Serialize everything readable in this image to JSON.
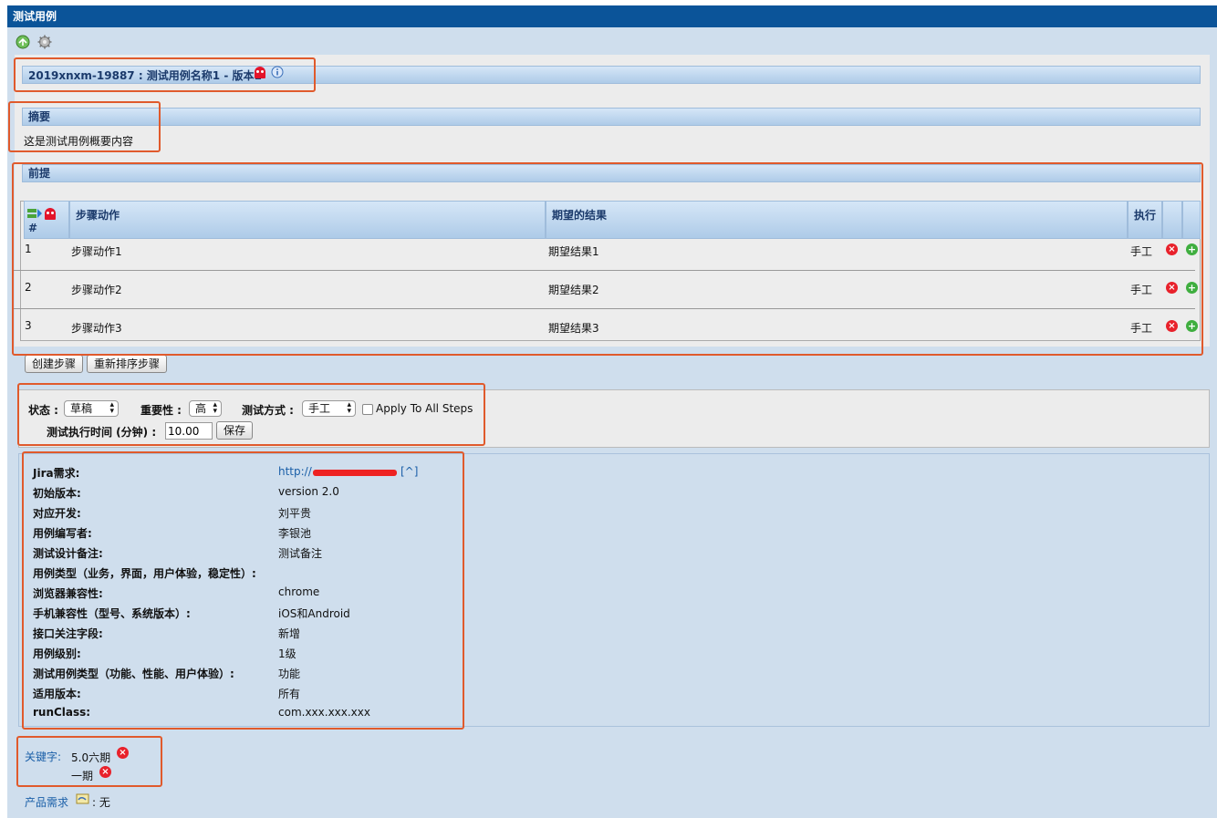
{
  "window": {
    "title": "测试用例"
  },
  "toolbar": {
    "export_icon": "export-icon",
    "settings_icon": "gear-icon"
  },
  "testcase": {
    "title": "2019xnxm-19887 : 测试用例名称1 - 版本1",
    "summary_header": "摘要",
    "summary_text": "这是测试用例概要内容",
    "preconditions_header": "前提"
  },
  "steps_table": {
    "hash": "#",
    "columns": {
      "action": "步骤动作",
      "expected": "期望的结果",
      "exec": "执行"
    },
    "rows": [
      {
        "num": "1",
        "action": "步骤动作1",
        "expected": "期望结果1",
        "exec": "手工"
      },
      {
        "num": "2",
        "action": "步骤动作2",
        "expected": "期望结果2",
        "exec": "手工"
      },
      {
        "num": "3",
        "action": "步骤动作3",
        "expected": "期望结果3",
        "exec": "手工"
      }
    ],
    "create_step_label": "创建步骤",
    "reorder_label": "重新排序步骤"
  },
  "attributes": {
    "status_label": "状态 :",
    "status_value": "草稿",
    "importance_label": "重要性 :",
    "importance_value": "高",
    "exec_type_label": "测试方式 :",
    "exec_type_value": "手工",
    "apply_all_label": "Apply To All Steps",
    "duration_label": "测试执行时间 (分钟) :",
    "duration_value": "10.00",
    "save_label": "保存"
  },
  "custom_fields": [
    {
      "label": "Jira需求:",
      "value": "http://",
      "suffix": "[^]"
    },
    {
      "label": "初始版本:",
      "value": "version 2.0"
    },
    {
      "label": "对应开发:",
      "value": "刘平贵"
    },
    {
      "label": "用例编写者:",
      "value": "李银池"
    },
    {
      "label": "测试设计备注:",
      "value": "测试备注"
    },
    {
      "label": "用例类型（业务，界面，用户体验，稳定性）:",
      "value": ""
    },
    {
      "label": "浏览器兼容性:",
      "value": "chrome"
    },
    {
      "label": "手机兼容性（型号、系统版本）:",
      "value": "iOS和Android"
    },
    {
      "label": "接口关注字段:",
      "value": "新增"
    },
    {
      "label": "用例级别:",
      "value": "1级"
    },
    {
      "label": "测试用例类型（功能、性能、用户体验）:",
      "value": "功能"
    },
    {
      "label": "适用版本:",
      "value": "所有"
    },
    {
      "label": "runClass:",
      "value": "com.xxx.xxx.xxx"
    }
  ],
  "keywords": {
    "label": "关键字:",
    "items": [
      "5.0六期",
      "一期"
    ]
  },
  "requirements": {
    "label": "产品需求",
    "value": ": 无"
  },
  "colors": {
    "titlebar": "#0b5499",
    "page_bg": "#cfdeed",
    "accent_red": "#e05a2c",
    "link": "#1a5fa8"
  }
}
